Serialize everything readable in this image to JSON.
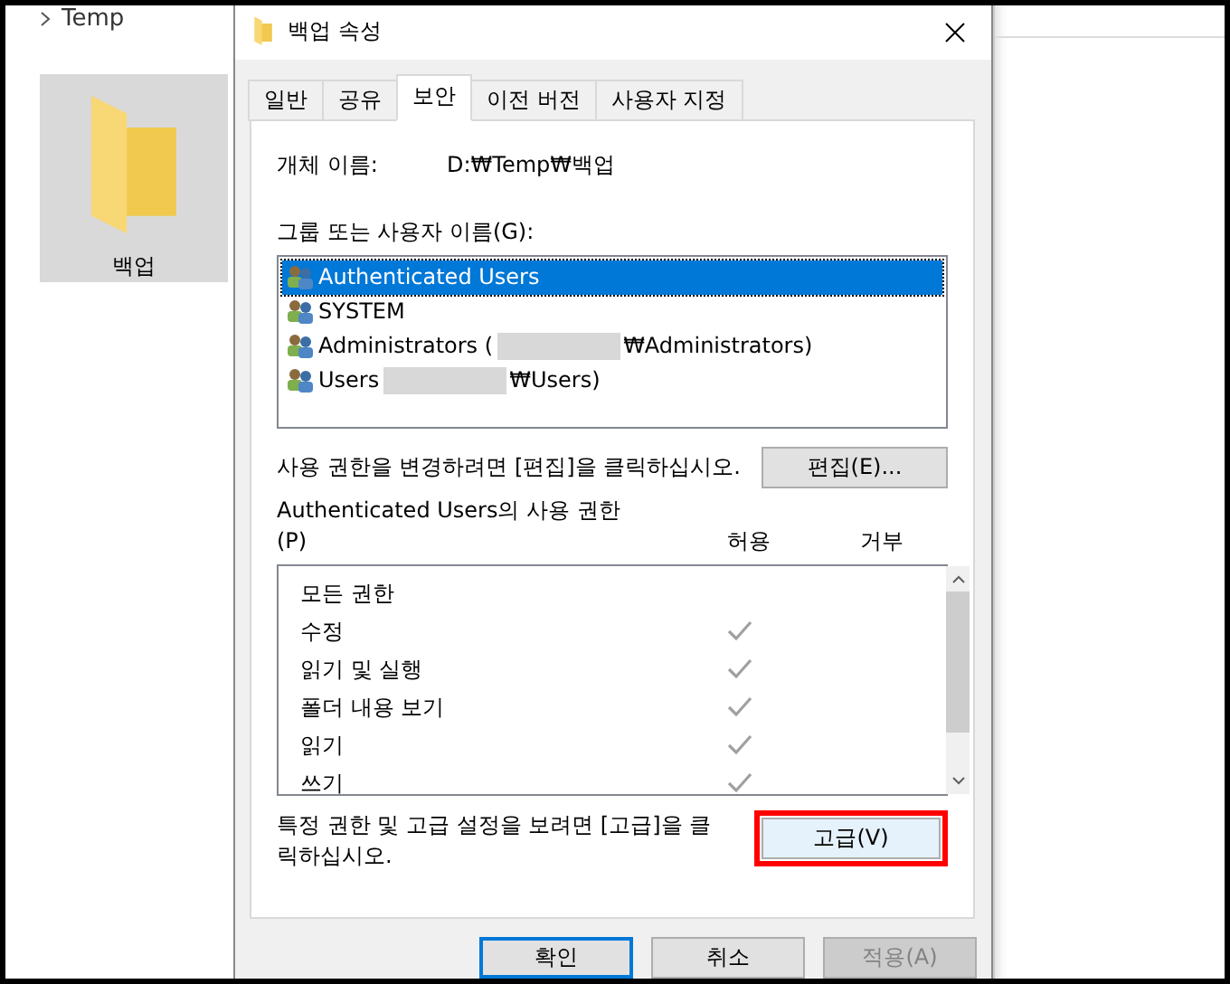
{
  "explorer": {
    "breadcrumb": "Temp",
    "folder": {
      "name": "백업",
      "selected": true
    }
  },
  "dialog": {
    "title": "백업 속성",
    "tabs": [
      {
        "label": "일반",
        "selected": false
      },
      {
        "label": "공유",
        "selected": false
      },
      {
        "label": "보안",
        "selected": true
      },
      {
        "label": "이전 버전",
        "selected": false
      },
      {
        "label": "사용자 지정",
        "selected": false
      }
    ],
    "object_name": {
      "label": "개체 이름:",
      "value": "D:₩Temp₩백업"
    },
    "users_label": "그룹 또는 사용자 이름(G):",
    "users": [
      {
        "text": "Authenticated Users",
        "redacted": false,
        "selected": true
      },
      {
        "text": "SYSTEM",
        "redacted": false,
        "selected": false
      },
      {
        "text": "Administrators (",
        "redacted": true,
        "text_after": "₩Administrators)",
        "selected": false
      },
      {
        "text": "Users",
        "redacted": true,
        "text_after": "₩Users)",
        "selected": false
      }
    ],
    "edit_hint": "사용 권한을 변경하려면 [편집]을 클릭하십시오.",
    "edit_button": "편집(E)...",
    "permissions_title": "Authenticated Users의 사용 권한",
    "permissions_key": "(P)",
    "allow_header": "허용",
    "deny_header": "거부",
    "permissions": [
      {
        "name": "모든 권한",
        "allow": false,
        "deny": false
      },
      {
        "name": "수정",
        "allow": true,
        "deny": false
      },
      {
        "name": "읽기 및 실행",
        "allow": true,
        "deny": false
      },
      {
        "name": "폴더 내용 보기",
        "allow": true,
        "deny": false
      },
      {
        "name": "읽기",
        "allow": true,
        "deny": false
      },
      {
        "name": "쓰기",
        "allow": true,
        "deny": false
      }
    ],
    "advanced_hint": "특정 권한 및 고급 설정을 보려면 [고급]을 클릭하십시오.",
    "advanced_button": {
      "label": "고급(V)",
      "highlighted": true
    },
    "buttons": [
      {
        "label": "확인",
        "kind": "default",
        "disabled": false
      },
      {
        "label": "취소",
        "kind": "normal",
        "disabled": false
      },
      {
        "label": "적용(A)",
        "kind": "normal",
        "disabled": true
      }
    ]
  }
}
